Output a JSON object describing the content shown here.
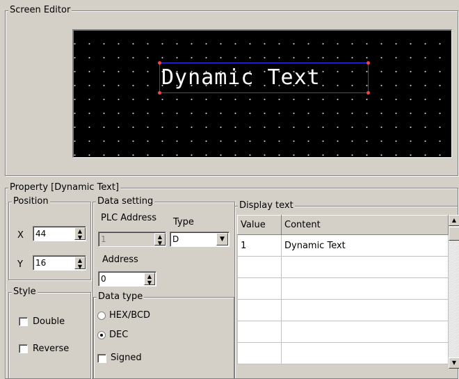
{
  "screen_editor": {
    "title": "Screen Editor",
    "canvas_text": "Dynamic Text"
  },
  "property": {
    "title": "Property [Dynamic Text]",
    "position": {
      "title": "Position",
      "x_label": "X",
      "x_value": "44",
      "y_label": "Y",
      "y_value": "16"
    },
    "style": {
      "title": "Style",
      "double_label": "Double",
      "double_checked": false,
      "reverse_label": "Reverse",
      "reverse_checked": false
    },
    "data_setting": {
      "title": "Data setting",
      "plc_address_label": "PLC Address",
      "plc_address_value": "1",
      "type_label": "Type",
      "type_value": "D",
      "address_label": "Address",
      "address_value": "0",
      "data_type": {
        "title": "Data type",
        "options": [
          "HEX/BCD",
          "DEC"
        ],
        "selected": "DEC"
      },
      "signed_label": "Signed",
      "signed_checked": false
    },
    "display_text": {
      "title": "Display text",
      "columns": [
        "Value",
        "Content"
      ],
      "rows": [
        {
          "value": "1",
          "content": "Dynamic Text"
        },
        {
          "value": "",
          "content": ""
        },
        {
          "value": "",
          "content": ""
        },
        {
          "value": "",
          "content": ""
        },
        {
          "value": "",
          "content": ""
        },
        {
          "value": "",
          "content": ""
        }
      ]
    }
  }
}
